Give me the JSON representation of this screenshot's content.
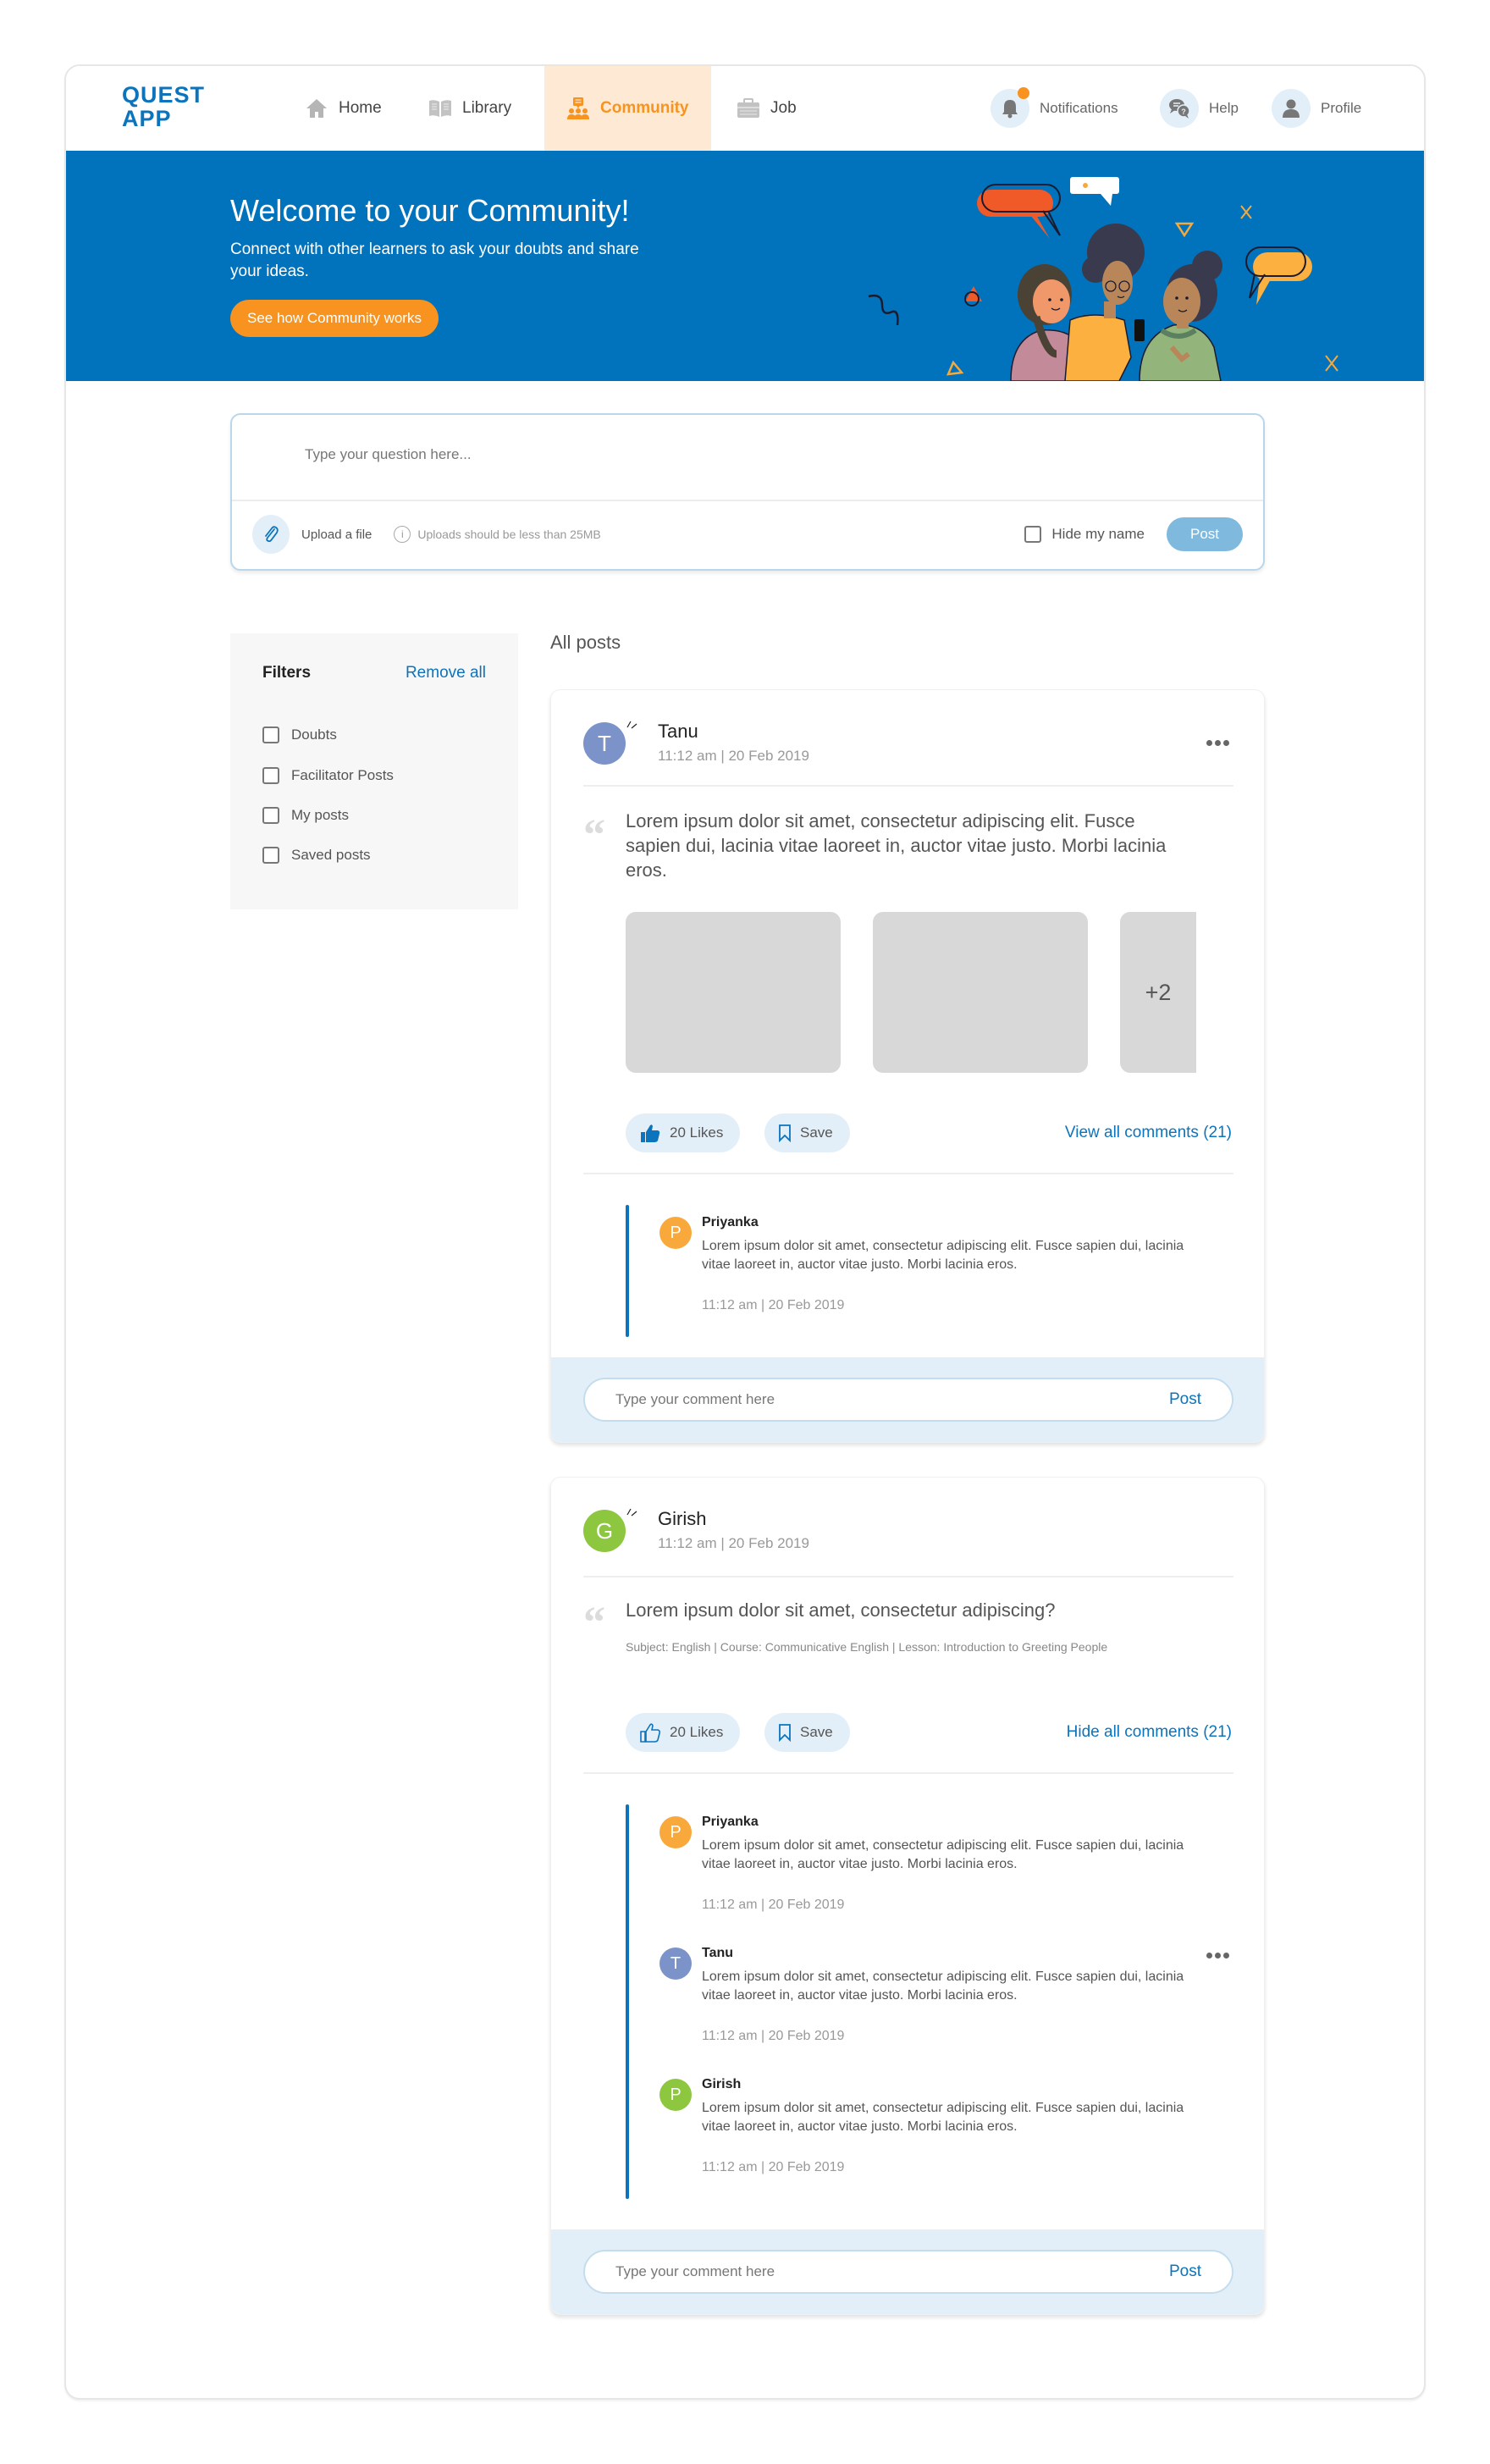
{
  "app": {
    "logo_line1": "QUEST",
    "logo_line2": "APP"
  },
  "nav": {
    "items": [
      {
        "label": "Home",
        "icon": "home-icon"
      },
      {
        "label": "Library",
        "icon": "book-icon"
      },
      {
        "label": "Community",
        "icon": "community-icon",
        "active": true
      },
      {
        "label": "Job",
        "icon": "briefcase-icon"
      }
    ],
    "right": [
      {
        "label": "Notifications",
        "icon": "bell-icon",
        "has_badge": true
      },
      {
        "label": "Help",
        "icon": "help-chat-icon"
      },
      {
        "label": "Profile",
        "icon": "user-icon"
      }
    ]
  },
  "banner": {
    "title": "Welcome to your Community!",
    "subtitle": "Connect with other learners to ask your doubts and share your ideas.",
    "cta": "See how Community works"
  },
  "composer": {
    "placeholder": "Type your question here...",
    "upload_label": "Upload a file",
    "upload_note": "Uploads should be less than 25MB",
    "hide_name_label": "Hide my name",
    "hide_name_checked": false,
    "post_label": "Post"
  },
  "filters": {
    "title": "Filters",
    "remove_all": "Remove all",
    "options": [
      {
        "label": "Doubts",
        "checked": false
      },
      {
        "label": "Facilitator Posts",
        "checked": false
      },
      {
        "label": "My posts",
        "checked": false
      },
      {
        "label": "Saved posts",
        "checked": false
      }
    ]
  },
  "feed": {
    "heading": "All posts",
    "posts": [
      {
        "author": "Tanu",
        "initial": "T",
        "avatar_color": "#7b93c9",
        "time": "11:12 am | 20 Feb 2019",
        "text": "Lorem ipsum dolor sit amet, consectetur adipiscing elit. Fusce sapien dui, lacinia vitae laoreet in, auctor vitae justo. Morbi lacinia eros.",
        "extra_images": "+2",
        "likes_label": "20 Likes",
        "liked": true,
        "save_label": "Save",
        "comments_toggle": "View all comments (21)",
        "comments": [
          {
            "author": "Priyanka",
            "initial": "P",
            "avatar_color": "#f9a93b",
            "text": "Lorem ipsum dolor sit amet, consectetur adipiscing elit. Fusce sapien dui, lacinia vitae laoreet in, auctor vitae justo. Morbi lacinia eros.",
            "time": "11:12 am | 20 Feb 2019"
          }
        ],
        "comment_placeholder": "Type your comment here",
        "comment_post": "Post"
      },
      {
        "author": "Girish",
        "initial": "G",
        "avatar_color": "#8dc63f",
        "time": "11:12 am | 20 Feb 2019",
        "text": "Lorem ipsum dolor sit amet, consectetur adipiscing?",
        "meta": "Subject: English | Course: Communicative English | Lesson: Introduction to Greeting People",
        "likes_label": "20 Likes",
        "liked": false,
        "save_label": "Save",
        "comments_toggle": "Hide all comments (21)",
        "comments": [
          {
            "author": "Priyanka",
            "initial": "P",
            "avatar_color": "#f9a93b",
            "text": "Lorem ipsum dolor sit amet, consectetur adipiscing elit. Fusce sapien dui, lacinia vitae laoreet in, auctor vitae justo. Morbi lacinia eros.",
            "time": "11:12 am | 20 Feb 2019"
          },
          {
            "author": "Tanu",
            "initial": "T",
            "avatar_color": "#7b93c9",
            "text": "Lorem ipsum dolor sit amet, consectetur adipiscing elit. Fusce sapien dui, lacinia vitae laoreet in, auctor vitae justo. Morbi lacinia eros.",
            "time": "11:12 am | 20 Feb 2019"
          },
          {
            "author": "Girish",
            "initial": "P",
            "avatar_color": "#8dc63f",
            "text": "Lorem ipsum dolor sit amet, consectetur adipiscing elit. Fusce sapien dui, lacinia vitae laoreet in, auctor vitae justo. Morbi lacinia eros.",
            "time": "11:12 am | 20 Feb 2019"
          }
        ],
        "comment_placeholder": "Type your comment here",
        "comment_post": "Post"
      }
    ]
  },
  "colors": {
    "brand_blue": "#0b74bd",
    "banner_blue": "#0073bc",
    "accent_orange": "#f7931e",
    "light_blue_bg": "#e3eff8"
  }
}
